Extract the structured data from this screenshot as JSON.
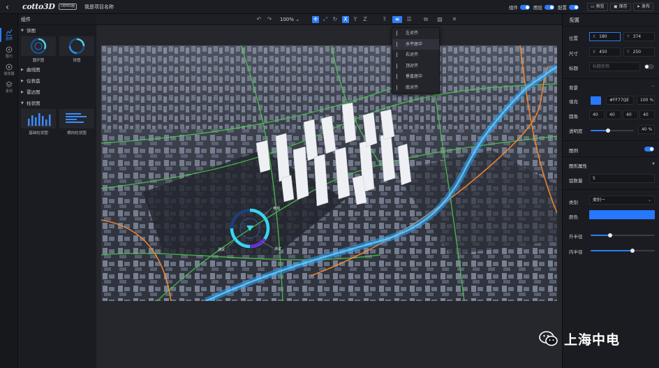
{
  "topbar": {
    "logo": "cotto3D",
    "badge": "DEMO版",
    "project_name": "我是项目名称",
    "toggles": [
      {
        "label": "组件",
        "on": true
      },
      {
        "label": "图层",
        "on": true
      },
      {
        "label": "配置",
        "on": true
      }
    ],
    "buttons": [
      {
        "label": "预览",
        "icon": "monitor-icon"
      },
      {
        "label": "保存",
        "icon": "save-icon"
      },
      {
        "label": "发布",
        "icon": "send-icon"
      }
    ]
  },
  "rail": {
    "items": [
      {
        "label": "图表",
        "icon": "chart-icon",
        "active": true
      },
      {
        "label": "图元",
        "icon": "shape-icon",
        "active": false
      },
      {
        "label": "播放器",
        "icon": "play-icon",
        "active": false
      },
      {
        "label": "素材",
        "icon": "layers-icon",
        "active": false
      }
    ]
  },
  "components": {
    "header": "组件",
    "categories": [
      {
        "label": "饼图",
        "expanded": true,
        "items": [
          {
            "label": "圆环图"
          },
          {
            "label": "饼图"
          }
        ]
      },
      {
        "label": "曲线图",
        "expanded": false
      },
      {
        "label": "仪表盘",
        "expanded": false
      },
      {
        "label": "雷达图",
        "expanded": false
      },
      {
        "label": "柱状图",
        "expanded": true,
        "items": [
          {
            "label": "基础柱状图"
          },
          {
            "label": "横向柱状图"
          }
        ]
      }
    ]
  },
  "toolbar": {
    "zoom": "100%",
    "axes": [
      "X",
      "Y",
      "Z"
    ],
    "active_axis": "X"
  },
  "align_menu": {
    "items": [
      {
        "label": "左对齐",
        "hover": false
      },
      {
        "label": "水平居中",
        "hover": true
      },
      {
        "label": "右对齐",
        "hover": false
      },
      {
        "label": "顶对齐",
        "hover": false
      },
      {
        "label": "垂直居中",
        "hover": false
      },
      {
        "label": "底对齐",
        "hover": false
      }
    ]
  },
  "viewport": {
    "ring_labels": [
      "参观",
      "测试",
      "测试"
    ]
  },
  "config": {
    "title": "配置",
    "position": {
      "label": "位置",
      "x_prefix": "X",
      "x": "180",
      "y_prefix": "Y",
      "y": "374"
    },
    "size": {
      "label": "尺寸",
      "w_prefix": "X",
      "w": "450",
      "h_prefix": "Y",
      "h": "250"
    },
    "title_row": {
      "label": "标题",
      "placeholder": "标题名称"
    },
    "background": {
      "section": "背景",
      "fill_label": "填充",
      "fill_value": "#FF77QE",
      "fill_percent": "100",
      "fill_unit": "%",
      "radius_label": "圆角",
      "radius": [
        "40",
        "40",
        "40",
        "40"
      ],
      "opacity_label": "透明度",
      "opacity_value": "40",
      "opacity_unit": "%",
      "opacity_fraction": 0.4
    },
    "legend": {
      "label": "图例",
      "on": true
    },
    "shape": {
      "section": "图形属性",
      "arc_count_label": "弧数量",
      "arc_count": "5",
      "category_label": "类别",
      "category_value": "类别一",
      "color_label": "颜色",
      "outer_radius_label": "外半径",
      "outer_radius_fraction": 0.3,
      "inner_radius_label": "内半径",
      "inner_radius_fraction": 0.65
    },
    "accent": "#2d7cf6",
    "swatch_color": "#2878ff"
  },
  "watermark": {
    "text": "上海中电"
  }
}
